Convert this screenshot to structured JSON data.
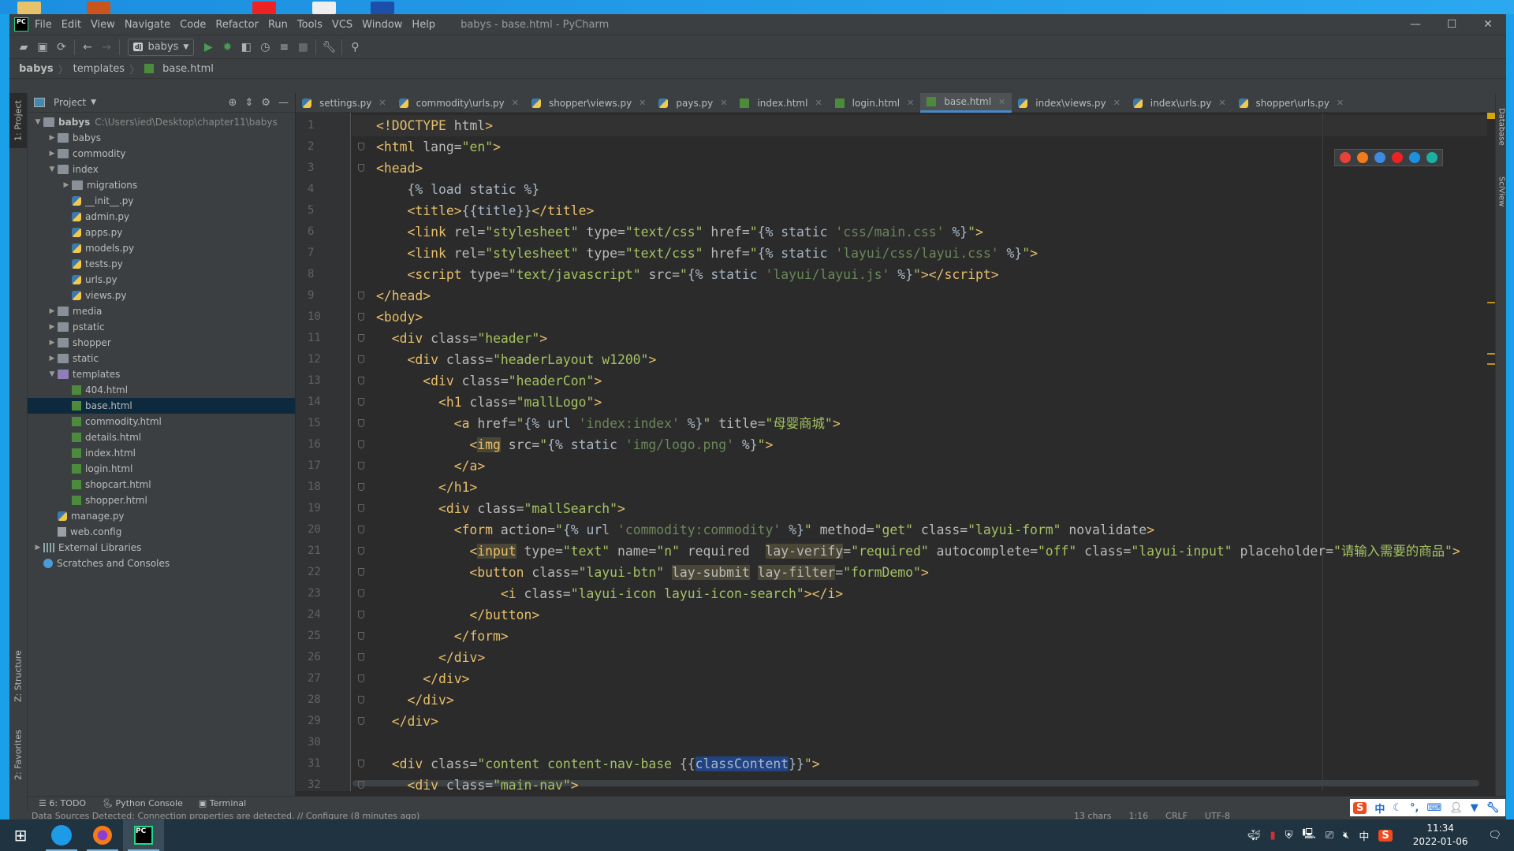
{
  "window": {
    "title": "babys - base.html - PyCharm",
    "logo": "PC"
  },
  "menu": [
    "File",
    "Edit",
    "View",
    "Navigate",
    "Code",
    "Refactor",
    "Run",
    "Tools",
    "VCS",
    "Window",
    "Help"
  ],
  "toolbar": {
    "run_config": "babys",
    "icons": [
      "open-folder-icon",
      "save-icon",
      "sync-icon",
      "back-icon",
      "forward-icon",
      "run-icon",
      "debug-icon",
      "coverage-icon",
      "profile-icon",
      "concurrency-icon",
      "stop-icon",
      "wrench-icon",
      "search-icon"
    ]
  },
  "breadcrumb": [
    "babys",
    "templates",
    "base.html"
  ],
  "left_strip": {
    "project": "1: Project",
    "structure": "Z: Structure",
    "favorites": "2: Favorites"
  },
  "right_strip": {
    "database": "Database",
    "sciview": "SciView"
  },
  "project": {
    "header": "Project",
    "tree": [
      {
        "label": "babys",
        "path": "C:\\Users\\ied\\Desktop\\chapter11\\babys",
        "depth": 0,
        "type": "folder",
        "expanded": true,
        "bold": true
      },
      {
        "label": "babys",
        "depth": 1,
        "type": "folder",
        "expanded": false
      },
      {
        "label": "commodity",
        "depth": 1,
        "type": "folder",
        "expanded": false
      },
      {
        "label": "index",
        "depth": 1,
        "type": "folder",
        "expanded": true
      },
      {
        "label": "migrations",
        "depth": 2,
        "type": "folder",
        "expanded": false
      },
      {
        "label": "__init__.py",
        "depth": 2,
        "type": "py"
      },
      {
        "label": "admin.py",
        "depth": 2,
        "type": "py"
      },
      {
        "label": "apps.py",
        "depth": 2,
        "type": "py"
      },
      {
        "label": "models.py",
        "depth": 2,
        "type": "py"
      },
      {
        "label": "tests.py",
        "depth": 2,
        "type": "py"
      },
      {
        "label": "urls.py",
        "depth": 2,
        "type": "py"
      },
      {
        "label": "views.py",
        "depth": 2,
        "type": "py"
      },
      {
        "label": "media",
        "depth": 1,
        "type": "folder",
        "expanded": false
      },
      {
        "label": "pstatic",
        "depth": 1,
        "type": "folder",
        "expanded": false
      },
      {
        "label": "shopper",
        "depth": 1,
        "type": "folder",
        "expanded": false
      },
      {
        "label": "static",
        "depth": 1,
        "type": "folder",
        "expanded": false
      },
      {
        "label": "templates",
        "depth": 1,
        "type": "tpl",
        "expanded": true
      },
      {
        "label": "404.html",
        "depth": 2,
        "type": "html"
      },
      {
        "label": "base.html",
        "depth": 2,
        "type": "html",
        "selected": true
      },
      {
        "label": "commodity.html",
        "depth": 2,
        "type": "html"
      },
      {
        "label": "details.html",
        "depth": 2,
        "type": "html"
      },
      {
        "label": "index.html",
        "depth": 2,
        "type": "html"
      },
      {
        "label": "login.html",
        "depth": 2,
        "type": "html"
      },
      {
        "label": "shopcart.html",
        "depth": 2,
        "type": "html"
      },
      {
        "label": "shopper.html",
        "depth": 2,
        "type": "html"
      },
      {
        "label": "manage.py",
        "depth": 1,
        "type": "py"
      },
      {
        "label": "web.config",
        "depth": 1,
        "type": "file"
      },
      {
        "label": "External Libraries",
        "depth": 0,
        "type": "lib",
        "expanded": false
      },
      {
        "label": "Scratches and Consoles",
        "depth": 0,
        "type": "scr"
      }
    ]
  },
  "tabs": [
    {
      "label": "settings.py",
      "type": "py"
    },
    {
      "label": "commodity\\urls.py",
      "type": "py"
    },
    {
      "label": "shopper\\views.py",
      "type": "py"
    },
    {
      "label": "pays.py",
      "type": "py"
    },
    {
      "label": "index.html",
      "type": "html"
    },
    {
      "label": "login.html",
      "type": "html"
    },
    {
      "label": "base.html",
      "type": "html",
      "active": true
    },
    {
      "label": "index\\views.py",
      "type": "py"
    },
    {
      "label": "index\\urls.py",
      "type": "py"
    },
    {
      "label": "shopper\\urls.py",
      "type": "py"
    }
  ],
  "editor": {
    "lines": [
      "<!DOCTYPE html>",
      "<html lang=\"en\">",
      "<head>",
      "    {% load static %}",
      "    <title>{{title}}</title>",
      "    <link rel=\"stylesheet\" type=\"text/css\" href=\"{% static 'css/main.css' %}\">",
      "    <link rel=\"stylesheet\" type=\"text/css\" href=\"{% static 'layui/css/layui.css' %}\">",
      "    <script type=\"text/javascript\" src=\"{% static 'layui/layui.js' %}\"></script>",
      "</head>",
      "<body>",
      "  <div class=\"header\">",
      "    <div class=\"headerLayout w1200\">",
      "      <div class=\"headerCon\">",
      "        <h1 class=\"mallLogo\">",
      "          <a href=\"{% url 'index:index' %}\" title=\"母婴商城\">",
      "            <img src=\"{% static 'img/logo.png' %}\">",
      "          </a>",
      "        </h1>",
      "        <div class=\"mallSearch\">",
      "          <form action=\"{% url 'commodity:commodity' %}\" method=\"get\" class=\"layui-form\" novalidate>",
      "            <input type=\"text\" name=\"n\" required  lay-verify=\"required\" autocomplete=\"off\" class=\"layui-input\" placeholder=\"请输入需要的商品\">",
      "            <button class=\"layui-btn\" lay-submit lay-filter=\"formDemo\">",
      "                <i class=\"layui-icon layui-icon-search\"></i>",
      "            </button>",
      "          </form>",
      "        </div>",
      "      </div>",
      "    </div>",
      "  </div>",
      "",
      "  <div class=\"content content-nav-base {{classContent}}\">",
      "    <div class=\"main-nav\">"
    ],
    "browsers": [
      "chrome-icon",
      "firefox-icon",
      "safari-icon",
      "opera-icon",
      "ie-icon",
      "edge-icon"
    ]
  },
  "bottom_tools": [
    {
      "label": "6: TODO",
      "icon": "todo-icon"
    },
    {
      "label": "Python Console",
      "icon": "python-console-icon"
    },
    {
      "label": "Terminal",
      "icon": "terminal-icon"
    }
  ],
  "status": {
    "message": "Data Sources Detected: Connection properties are detected. // Configure (8 minutes ago)",
    "chars": "13 chars",
    "position": "1:16",
    "line_sep": "CRLF",
    "encoding": "UTF-8"
  },
  "ime": {
    "mode": "中"
  },
  "taskbar": {
    "apps": [
      "docker-icon",
      "firefox-icon",
      "pycharm-icon"
    ],
    "time": "11:34",
    "date": "2022-01-06",
    "lang": "中"
  },
  "colors": {
    "tag": "#e8bf6a",
    "attr": "#bababa",
    "string": "#a5c261",
    "text": "#a9b7c6",
    "accent": "#4a88c7"
  }
}
